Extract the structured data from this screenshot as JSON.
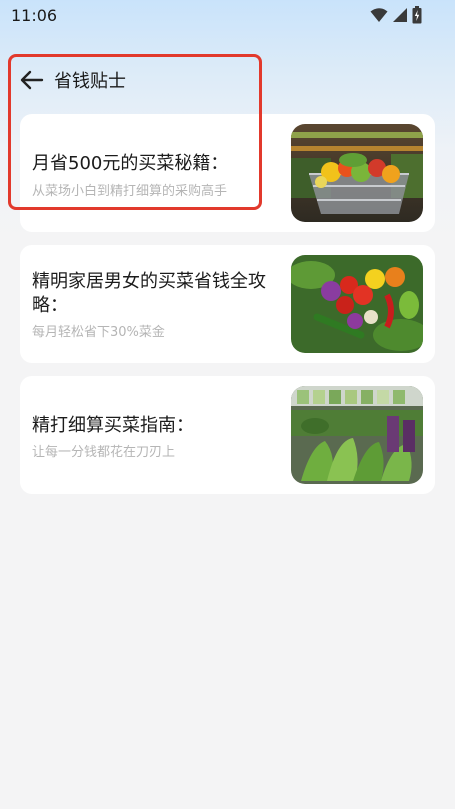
{
  "status_bar": {
    "time": "11:06",
    "icons": [
      "wifi-icon",
      "signal-icon",
      "battery-icon"
    ]
  },
  "header": {
    "back_icon": "back-arrow-icon",
    "title": "省钱贴士"
  },
  "articles": [
    {
      "title": "月省500元的买菜秘籍：",
      "subtitle": "从菜场小白到精打细算的采购高手",
      "image": "supermarket-cart-vegetables"
    },
    {
      "title": "精明家居男女的买菜省钱全攻略：",
      "subtitle": "每月轻松省下30%菜金",
      "image": "fresh-vegetables-peppers-tomatoes"
    },
    {
      "title": "精打细算买菜指南：",
      "subtitle": "让每一分钱都花在刀刃上",
      "image": "market-vegetable-stall"
    }
  ],
  "colors": {
    "highlight": "#e2392c",
    "card_background": "#ffffff",
    "subtitle_text": "#b5b5b5"
  }
}
